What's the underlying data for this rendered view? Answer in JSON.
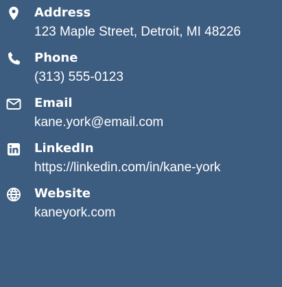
{
  "contact": {
    "items": [
      {
        "icon": "map-marker-icon",
        "label": "Address",
        "value": "123 Maple Street, Detroit, MI 48226"
      },
      {
        "icon": "phone-icon",
        "label": "Phone",
        "value": "(313) 555-0123"
      },
      {
        "icon": "envelope-icon",
        "label": "Email",
        "value": "kane.york@email.com"
      },
      {
        "icon": "linkedin-icon",
        "label": "LinkedIn",
        "value": "https://linkedin.com/in/kane-york"
      },
      {
        "icon": "globe-icon",
        "label": "Website",
        "value": "kaneyork.com"
      }
    ]
  },
  "colors": {
    "background": "#3d5d80",
    "text": "#ffffff"
  }
}
